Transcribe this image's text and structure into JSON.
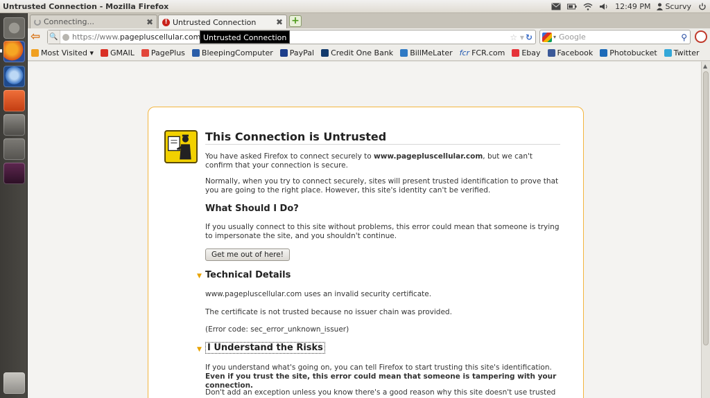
{
  "window": {
    "title": "Untrusted Connection - Mozilla Firefox"
  },
  "tray": {
    "time": "12:49 PM",
    "user": "Scurvy"
  },
  "tabs": [
    {
      "label": "Connecting...",
      "close": "✖"
    },
    {
      "label": "Untrusted Connection",
      "close": "✖"
    }
  ],
  "new_tab": "+",
  "nav": {
    "url_scheme": "https://www.",
    "url_host": "pagepluscellular.com",
    "tooltip": "Untrusted Connection",
    "search_placeholder": "Google"
  },
  "bookmarks": [
    {
      "label": "Most Visited ▾",
      "color": "#f0a020"
    },
    {
      "label": "GMAIL",
      "color": "#d93025"
    },
    {
      "label": "PagePlus",
      "color": "#e2463a"
    },
    {
      "label": "BleepingComputer",
      "color": "#2a5da8"
    },
    {
      "label": "PayPal",
      "color": "#1d3f8b"
    },
    {
      "label": "Credit One Bank",
      "color": "#123a6c"
    },
    {
      "label": "BillMeLater",
      "color": "#2f7ac4"
    },
    {
      "label": "FCR.com",
      "prefix": "fcr",
      "color": "#1e56b0"
    },
    {
      "label": "Ebay",
      "color": "#e53238"
    },
    {
      "label": "Facebook",
      "color": "#3b5998"
    },
    {
      "label": "Photobucket",
      "color": "#1c6ab8"
    },
    {
      "label": "Twitter",
      "color": "#33a7d8"
    }
  ],
  "error": {
    "title": "This Connection is Untrusted",
    "p1_pre": "You have asked Firefox to connect securely to ",
    "p1_host": "www.pagepluscellular.com",
    "p1_post": ", but we can't confirm that your connection is secure.",
    "p2": "Normally, when you try to connect securely, sites will present trusted identification to prove that you are going to the right place. However, this site's identity can't be verified.",
    "what_title": "What Should I Do?",
    "p3": "If you usually connect to this site without problems, this error could mean that someone is trying to impersonate the site, and you shouldn't continue.",
    "getout": "Get me out of here!",
    "tech_title": "Technical Details",
    "tech1": "www.pagepluscellular.com uses an invalid security certificate.",
    "tech2": "The certificate is not trusted because no issuer chain was provided.",
    "tech3": "(Error code: sec_error_unknown_issuer)",
    "risks_title": "I Understand the Risks",
    "risk1_pre": "If you understand what's going on, you can tell Firefox to start trusting this site's identification. ",
    "risk1_bold": "Even if you trust the site, this error could mean that someone is tampering with your connection.",
    "risk2": "Don't add an exception unless you know there's a good reason why this site doesn't use trusted identification."
  }
}
